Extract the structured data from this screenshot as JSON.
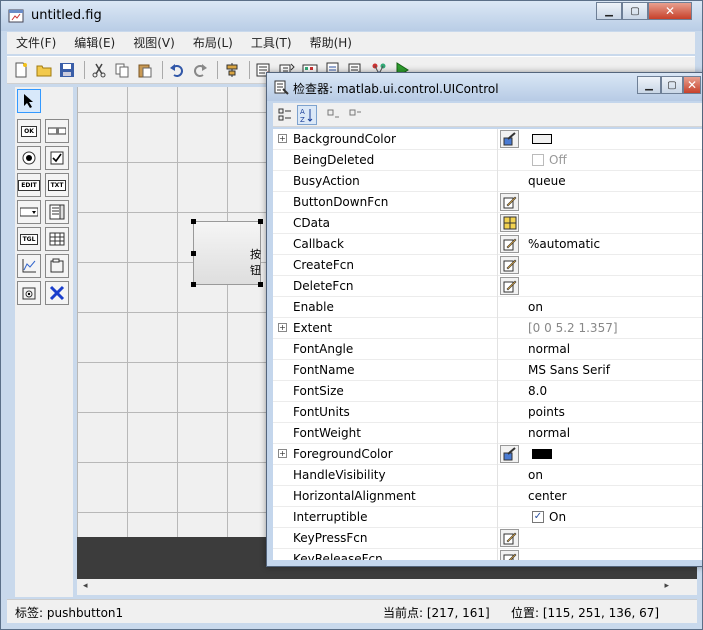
{
  "window": {
    "title": "untitled.fig",
    "min": "▁",
    "max": "▢",
    "close": "✕"
  },
  "menus": [
    "文件(F)",
    "编辑(E)",
    "视图(V)",
    "布局(L)",
    "工具(T)",
    "帮助(H)"
  ],
  "toolbar_icons": [
    "new-file-icon",
    "open-folder-icon",
    "save-icon",
    "cut-icon",
    "copy-icon",
    "paste-icon",
    "undo-icon",
    "redo-icon",
    "align-icon",
    "menu-editor-icon",
    "tab-order-icon",
    "toolbar-editor-icon",
    "mfile-editor-icon",
    "inspector-icon",
    "object-browser-icon",
    "run-icon"
  ],
  "palette": [
    {
      "name": "select-tool",
      "label": ""
    },
    {
      "name": "pushbutton-tool",
      "label": "OK"
    },
    {
      "name": "slider-tool",
      "label": ""
    },
    {
      "name": "radio-tool",
      "label": ""
    },
    {
      "name": "checkbox-tool",
      "label": ""
    },
    {
      "name": "edit-text-tool",
      "label": "EDIT"
    },
    {
      "name": "static-text-tool",
      "label": "TXT"
    },
    {
      "name": "popup-menu-tool",
      "label": ""
    },
    {
      "name": "listbox-tool",
      "label": ""
    },
    {
      "name": "toggle-tool",
      "label": "TGL"
    },
    {
      "name": "table-tool",
      "label": ""
    },
    {
      "name": "axes-tool",
      "label": ""
    },
    {
      "name": "panel-tool",
      "label": ""
    },
    {
      "name": "button-group-tool",
      "label": ""
    },
    {
      "name": "activex-tool",
      "label": ""
    }
  ],
  "canvas": {
    "button_label": "按钮"
  },
  "status": {
    "tag": "标签: pushbutton1",
    "current_point": "当前点:  [217, 161]",
    "position": "位置: [115, 251, 136, 67]"
  },
  "inspector": {
    "title": "检查器:  matlab.ui.control.UIControl",
    "properties": [
      {
        "name": "BackgroundColor",
        "expand": true,
        "btn": "palette",
        "swatch": "#f0f0f0"
      },
      {
        "name": "BeingDeleted",
        "checkbox": false,
        "value": "Off",
        "disabled": true
      },
      {
        "name": "BusyAction",
        "value": "queue"
      },
      {
        "name": "ButtonDownFcn",
        "btn": "edit"
      },
      {
        "name": "CData",
        "btn": "grid"
      },
      {
        "name": "Callback",
        "btn": "edit",
        "value": "%automatic"
      },
      {
        "name": "CreateFcn",
        "btn": "edit"
      },
      {
        "name": "DeleteFcn",
        "btn": "edit"
      },
      {
        "name": "Enable",
        "value": "on"
      },
      {
        "name": "Extent",
        "expand": true,
        "value": "[0 0 5.2 1.357]",
        "gray": true
      },
      {
        "name": "FontAngle",
        "value": "normal"
      },
      {
        "name": "FontName",
        "value": "MS Sans Serif"
      },
      {
        "name": "FontSize",
        "value": "8.0"
      },
      {
        "name": "FontUnits",
        "value": "points"
      },
      {
        "name": "FontWeight",
        "value": "normal"
      },
      {
        "name": "ForegroundColor",
        "expand": true,
        "btn": "palette",
        "swatch": "#000000"
      },
      {
        "name": "HandleVisibility",
        "value": "on"
      },
      {
        "name": "HorizontalAlignment",
        "value": "center"
      },
      {
        "name": "Interruptible",
        "checkbox": true,
        "value": "On"
      },
      {
        "name": "KeyPressFcn",
        "btn": "edit"
      },
      {
        "name": "KeyReleaseFcn",
        "btn": "edit"
      }
    ]
  }
}
